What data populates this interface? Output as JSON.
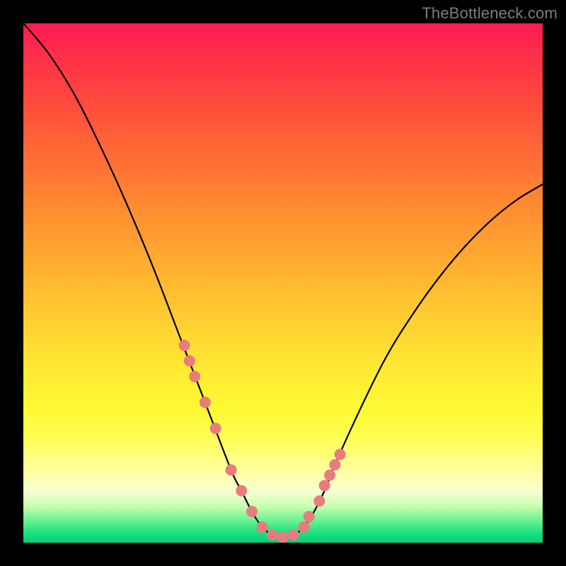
{
  "watermark": "TheBottleneck.com",
  "colors": {
    "curve_stroke": "#000000",
    "dot_fill": "#e97b7e",
    "background_black": "#000000"
  },
  "chart_data": {
    "type": "line",
    "title": "",
    "xlabel": "",
    "ylabel": "",
    "xlim": [
      0,
      100
    ],
    "ylim": [
      0,
      100
    ],
    "x": [
      0,
      5,
      10,
      15,
      20,
      25,
      30,
      35,
      40,
      42,
      44,
      46,
      48,
      50,
      52,
      54,
      56,
      58,
      60,
      65,
      70,
      75,
      80,
      85,
      90,
      95,
      100
    ],
    "y": [
      100,
      94,
      86,
      76,
      65,
      53,
      40,
      27,
      14,
      10,
      6,
      3,
      1.5,
      1,
      1.5,
      3,
      6,
      10,
      15,
      26,
      36,
      44,
      51,
      57,
      62,
      66,
      69
    ],
    "markers": {
      "x": [
        31,
        32,
        33,
        35,
        37,
        40,
        42,
        44,
        46,
        48,
        50,
        52,
        54,
        55,
        57,
        58,
        59,
        60,
        61
      ],
      "y": [
        38,
        35,
        32,
        27,
        22,
        14,
        10,
        6,
        3,
        1.5,
        1,
        1.5,
        3,
        5,
        8,
        11,
        13,
        15,
        17
      ]
    }
  }
}
